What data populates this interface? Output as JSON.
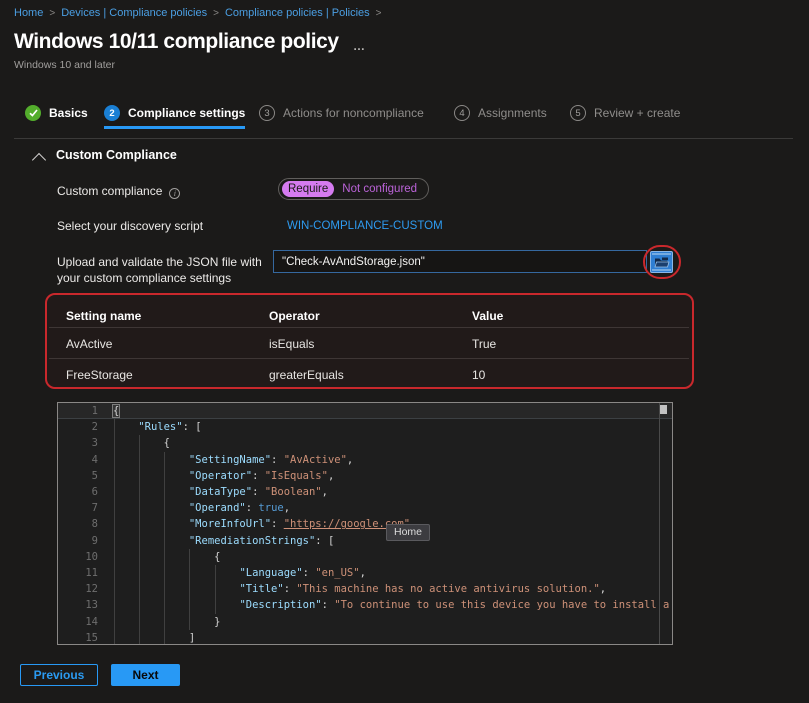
{
  "breadcrumb": {
    "items": [
      "Home",
      "Devices | Compliance policies",
      "Compliance policies | Policies"
    ],
    "separator": ">"
  },
  "header": {
    "title": "Windows 10/11 compliance policy",
    "more_menu": "...",
    "subtitle": "Windows 10 and later"
  },
  "tabs": [
    {
      "label": "Basics",
      "indicator": "check",
      "state": "done"
    },
    {
      "label": "Compliance settings",
      "indicator": "2",
      "state": "active"
    },
    {
      "label": "Actions for noncompliance",
      "indicator": "3",
      "state": "upcoming"
    },
    {
      "label": "Assignments",
      "indicator": "4",
      "state": "upcoming"
    },
    {
      "label": "Review + create",
      "indicator": "5",
      "state": "upcoming"
    }
  ],
  "section": {
    "title": "Custom Compliance"
  },
  "form": {
    "compliance_row": {
      "label": "Custom compliance",
      "options": [
        {
          "label": "Require",
          "selected": true
        },
        {
          "label": "Not configured",
          "selected": false
        }
      ]
    },
    "script_row": {
      "label": "Select your discovery script",
      "link": "WIN-COMPLIANCE-CUSTOM"
    },
    "upload_row": {
      "label_line1": "Upload and validate the JSON file with",
      "label_line2": "your custom compliance settings",
      "value": "\"Check-AvAndStorage.json\""
    }
  },
  "table": {
    "columns": [
      "Setting name",
      "Operator",
      "Value"
    ],
    "rows": [
      [
        "AvActive",
        "isEquals",
        "True"
      ],
      [
        "FreeStorage",
        "greaterEquals",
        "10"
      ]
    ]
  },
  "editor": {
    "tooltip": "Home",
    "lines": [
      {
        "n": 1,
        "ind": 0,
        "tokens": [
          {
            "c": "brkt",
            "v": "{"
          }
        ]
      },
      {
        "n": 2,
        "ind": 4,
        "tokens": [
          {
            "c": "key",
            "v": "\"Rules\""
          },
          {
            "c": "punc",
            "v": ": ["
          }
        ]
      },
      {
        "n": 3,
        "ind": 8,
        "tokens": [
          {
            "c": "punc",
            "v": "{"
          }
        ]
      },
      {
        "n": 4,
        "ind": 12,
        "tokens": [
          {
            "c": "key",
            "v": "\"SettingName\""
          },
          {
            "c": "punc",
            "v": ": "
          },
          {
            "c": "str",
            "v": "\"AvActive\""
          },
          {
            "c": "punc",
            "v": ","
          }
        ]
      },
      {
        "n": 5,
        "ind": 12,
        "tokens": [
          {
            "c": "key",
            "v": "\"Operator\""
          },
          {
            "c": "punc",
            "v": ": "
          },
          {
            "c": "str",
            "v": "\"IsEquals\""
          },
          {
            "c": "punc",
            "v": ","
          }
        ]
      },
      {
        "n": 6,
        "ind": 12,
        "tokens": [
          {
            "c": "key",
            "v": "\"DataType\""
          },
          {
            "c": "punc",
            "v": ": "
          },
          {
            "c": "str",
            "v": "\"Boolean\""
          },
          {
            "c": "punc",
            "v": ","
          }
        ]
      },
      {
        "n": 7,
        "ind": 12,
        "tokens": [
          {
            "c": "key",
            "v": "\"Operand\""
          },
          {
            "c": "punc",
            "v": ": "
          },
          {
            "c": "kw",
            "v": "true"
          },
          {
            "c": "punc",
            "v": ","
          }
        ]
      },
      {
        "n": 8,
        "ind": 12,
        "tokens": [
          {
            "c": "key",
            "v": "\"MoreInfoUrl\""
          },
          {
            "c": "punc",
            "v": ": "
          },
          {
            "c": "link",
            "v": "\"https://google.com\""
          },
          {
            "c": "punc",
            "v": ","
          }
        ]
      },
      {
        "n": 9,
        "ind": 12,
        "tokens": [
          {
            "c": "key",
            "v": "\"RemediationStrings\""
          },
          {
            "c": "punc",
            "v": ": ["
          }
        ]
      },
      {
        "n": 10,
        "ind": 16,
        "tokens": [
          {
            "c": "punc",
            "v": "{"
          }
        ]
      },
      {
        "n": 11,
        "ind": 20,
        "tokens": [
          {
            "c": "key",
            "v": "\"Language\""
          },
          {
            "c": "punc",
            "v": ": "
          },
          {
            "c": "str",
            "v": "\"en_US\""
          },
          {
            "c": "punc",
            "v": ","
          }
        ]
      },
      {
        "n": 12,
        "ind": 20,
        "tokens": [
          {
            "c": "key",
            "v": "\"Title\""
          },
          {
            "c": "punc",
            "v": ": "
          },
          {
            "c": "str",
            "v": "\"This machine has no active antivirus solution.\""
          },
          {
            "c": "punc",
            "v": ","
          }
        ]
      },
      {
        "n": 13,
        "ind": 20,
        "tokens": [
          {
            "c": "key",
            "v": "\"Description\""
          },
          {
            "c": "punc",
            "v": ": "
          },
          {
            "c": "str",
            "v": "\"To continue to use this device you have to install a"
          }
        ]
      },
      {
        "n": 14,
        "ind": 16,
        "tokens": [
          {
            "c": "punc",
            "v": "}"
          }
        ]
      },
      {
        "n": 15,
        "ind": 12,
        "tokens": [
          {
            "c": "punc",
            "v": "]"
          }
        ]
      }
    ]
  },
  "footer": {
    "previous_label": "Previous",
    "next_label": "Next"
  },
  "colors": {
    "accent_blue": "#2899f5",
    "annotation_red": "#c9282c",
    "success_green": "#53ad2c",
    "toggle_magenta": "#d57bf0",
    "link_blue": "#2e9bf0",
    "breadcrumb_blue": "#4b9fe3"
  }
}
